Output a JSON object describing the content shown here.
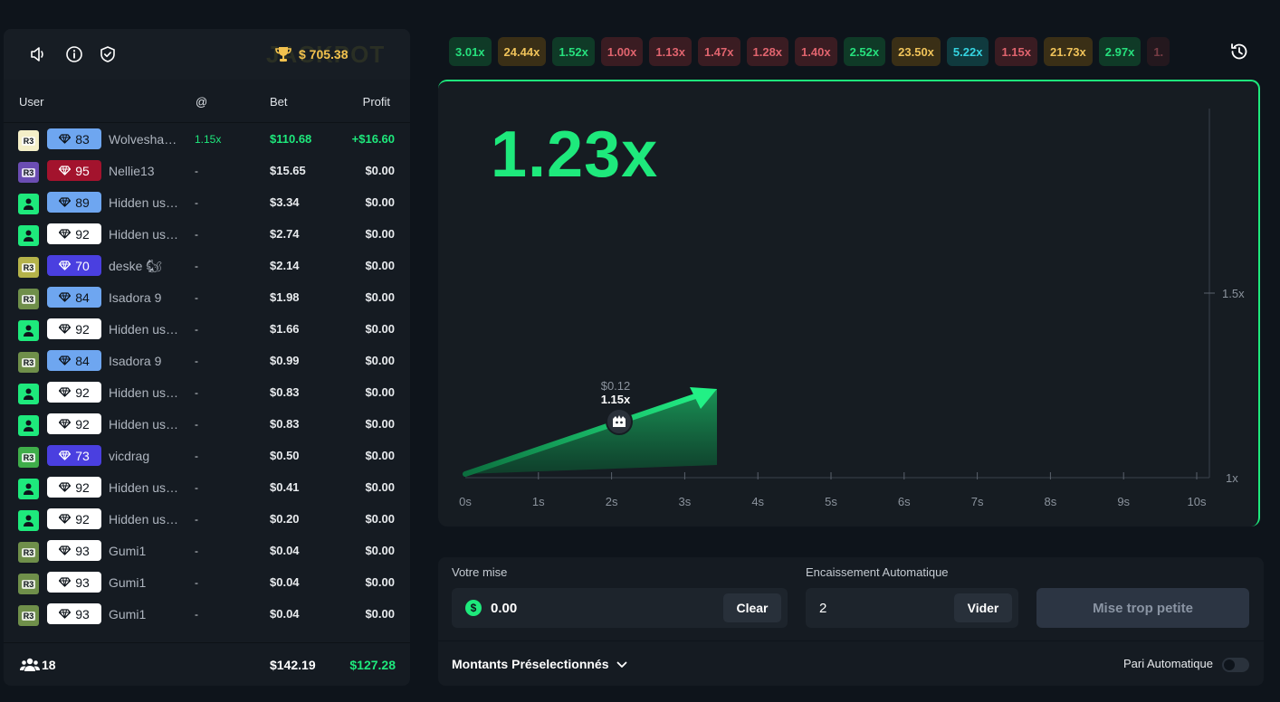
{
  "leaderboard": {
    "jackpot_watermark": "JACKPOT",
    "jackpot_value": "$ 705.38",
    "headers": {
      "user": "User",
      "cashout": "@",
      "bet": "Bet",
      "profit": "Profit"
    },
    "rows": [
      {
        "avatar": "cream",
        "level": "83",
        "badge": "blue",
        "name": "Wolvesha…",
        "cashout": "1.15x",
        "bet": "$110.68",
        "profit": "+$16.60",
        "win": true
      },
      {
        "avatar": "purple",
        "level": "95",
        "badge": "red",
        "name": "Nellie13",
        "cashout": "-",
        "bet": "$15.65",
        "profit": "$0.00"
      },
      {
        "avatar": "green",
        "level": "89",
        "badge": "blue",
        "name": "Hidden us…",
        "cashout": "-",
        "bet": "$3.34",
        "profit": "$0.00"
      },
      {
        "avatar": "green",
        "level": "92",
        "badge": "white",
        "name": "Hidden us…",
        "cashout": "-",
        "bet": "$2.74",
        "profit": "$0.00"
      },
      {
        "avatar": "olive",
        "level": "70",
        "badge": "indigo",
        "name": "deske 🐿",
        "cashout": "-",
        "bet": "$2.14",
        "profit": "$0.00"
      },
      {
        "avatar": "camo",
        "level": "84",
        "badge": "blue",
        "name": "Isadora 9",
        "cashout": "-",
        "bet": "$1.98",
        "profit": "$0.00"
      },
      {
        "avatar": "green",
        "level": "92",
        "badge": "white",
        "name": "Hidden us…",
        "cashout": "-",
        "bet": "$1.66",
        "profit": "$0.00"
      },
      {
        "avatar": "camo",
        "level": "84",
        "badge": "blue",
        "name": "Isadora 9",
        "cashout": "-",
        "bet": "$0.99",
        "profit": "$0.00"
      },
      {
        "avatar": "green",
        "level": "92",
        "badge": "white",
        "name": "Hidden us…",
        "cashout": "-",
        "bet": "$0.83",
        "profit": "$0.00"
      },
      {
        "avatar": "green",
        "level": "92",
        "badge": "white",
        "name": "Hidden us…",
        "cashout": "-",
        "bet": "$0.83",
        "profit": "$0.00"
      },
      {
        "avatar": "lime",
        "level": "73",
        "badge": "indigo",
        "name": "vicdrag",
        "cashout": "-",
        "bet": "$0.50",
        "profit": "$0.00"
      },
      {
        "avatar": "green",
        "level": "92",
        "badge": "white",
        "name": "Hidden us…",
        "cashout": "-",
        "bet": "$0.41",
        "profit": "$0.00"
      },
      {
        "avatar": "green",
        "level": "92",
        "badge": "white",
        "name": "Hidden us…",
        "cashout": "-",
        "bet": "$0.20",
        "profit": "$0.00"
      },
      {
        "avatar": "camo",
        "level": "93",
        "badge": "white",
        "name": "Gumi1",
        "cashout": "-",
        "bet": "$0.04",
        "profit": "$0.00"
      },
      {
        "avatar": "camo",
        "level": "93",
        "badge": "white",
        "name": "Gumi1",
        "cashout": "-",
        "bet": "$0.04",
        "profit": "$0.00"
      },
      {
        "avatar": "camo",
        "level": "93",
        "badge": "white",
        "name": "Gumi1",
        "cashout": "-",
        "bet": "$0.04",
        "profit": "$0.00"
      }
    ],
    "footer": {
      "players": "18",
      "total_bet": "$142.19",
      "total_profit": "$127.28"
    }
  },
  "history": [
    {
      "value": "3.01x",
      "tier": "green"
    },
    {
      "value": "24.44x",
      "tier": "gold"
    },
    {
      "value": "1.52x",
      "tier": "green"
    },
    {
      "value": "1.00x",
      "tier": "red"
    },
    {
      "value": "1.13x",
      "tier": "red"
    },
    {
      "value": "1.47x",
      "tier": "red"
    },
    {
      "value": "1.28x",
      "tier": "red"
    },
    {
      "value": "1.40x",
      "tier": "red"
    },
    {
      "value": "2.52x",
      "tier": "green"
    },
    {
      "value": "23.50x",
      "tier": "gold"
    },
    {
      "value": "5.22x",
      "tier": "teal"
    },
    {
      "value": "1.15x",
      "tier": "red"
    },
    {
      "value": "21.73x",
      "tier": "gold"
    },
    {
      "value": "2.97x",
      "tier": "green"
    },
    {
      "value": "1.",
      "tier": "red"
    }
  ],
  "game": {
    "multiplier": "1.23x",
    "y_ticks": [
      "1.5x",
      "1x"
    ],
    "x_ticks": [
      "0s",
      "1s",
      "2s",
      "3s",
      "4s",
      "5s",
      "6s",
      "7s",
      "8s",
      "9s",
      "10s"
    ],
    "marker_amount": "$0.12",
    "marker_multiplier": "1.15x"
  },
  "bet_panel": {
    "stake_label": "Votre mise",
    "stake_value": "0.00",
    "clear_label": "Clear",
    "autocash_label": "Encaissement Automatique",
    "autocash_value": "2",
    "vider_label": "Vider",
    "submit_label": "Mise trop petite",
    "presets_label": "Montants Préselectionnés",
    "auto_bet_label": "Pari Automatique"
  },
  "colors": {
    "accent_green": "#1ee97c",
    "gold": "#f2c14e",
    "pill_green_bg": "#0f3a27",
    "pill_green_fg": "#26e07d",
    "pill_red_bg": "#3a1c22",
    "pill_red_fg": "#e0646e",
    "pill_gold_bg": "#3a2f16",
    "pill_gold_fg": "#f0c35a",
    "pill_teal_bg": "#103a3e",
    "pill_teal_fg": "#35d3e0"
  }
}
